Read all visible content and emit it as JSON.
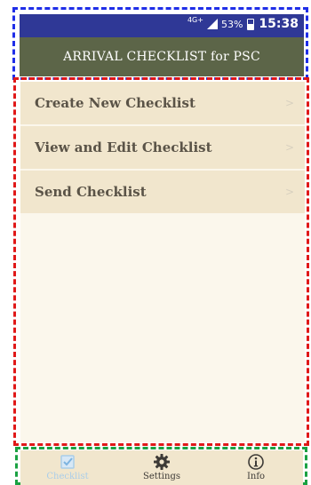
{
  "status_bar": {
    "network": "4G+",
    "battery": "53%",
    "time": "15:38"
  },
  "header": {
    "title": "ARRIVAL CHECKLIST for PSC"
  },
  "menu": {
    "items": [
      {
        "label": "Create New Checklist",
        "chevron": ">"
      },
      {
        "label": "View and Edit Checklist",
        "chevron": ">"
      },
      {
        "label": "Send Checklist",
        "chevron": ">"
      }
    ]
  },
  "tabs": [
    {
      "label": "Checklist",
      "icon": "checkbox-icon",
      "active": true
    },
    {
      "label": "Settings",
      "icon": "gear-icon",
      "active": false
    },
    {
      "label": "Info",
      "icon": "info-icon",
      "active": false
    }
  ],
  "colors": {
    "status_bar": "#2f3896",
    "title_bar": "#5c6548",
    "menu_item_bg": "#f1e6cd",
    "content_bg": "#fbf7ec",
    "active_tab": "#a9cde9"
  }
}
